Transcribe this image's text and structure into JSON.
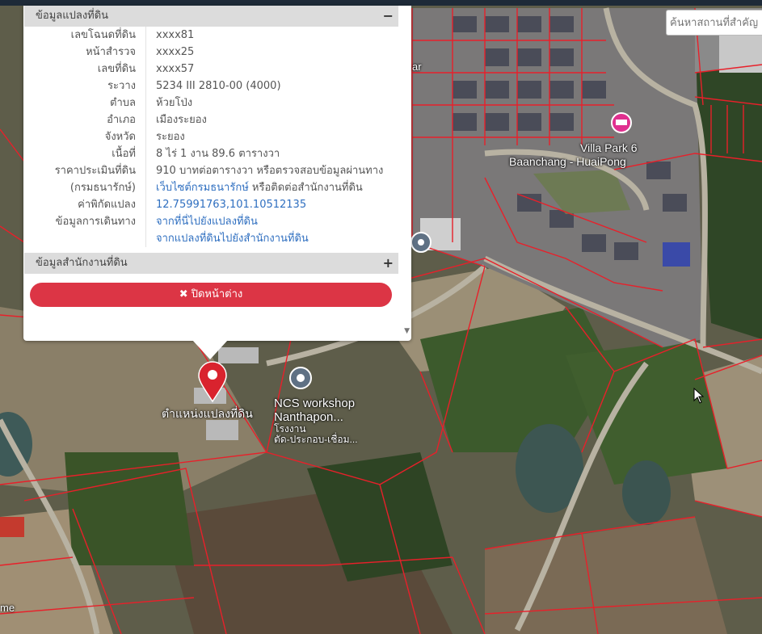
{
  "search": {
    "placeholder": "ค้นหาสถานที่สำคัญ"
  },
  "map_labels": {
    "villa_line1": "Villa Park 6",
    "villa_line2": "Baanchang - HuaiPong",
    "ncs_line1": "NCS workshop",
    "ncs_line2": "Nanthapon...",
    "ncs_line3": "โรงงาน",
    "ncs_line4": "ตัด-ประกอบ-เชื่อม...",
    "parcel_marker": "ตำแหน่งแปลงที่ดิน",
    "edge_ar": "ar",
    "edge_me": "me"
  },
  "panel": {
    "section1_title": "ข้อมูลแปลงที่ดิน",
    "section1_toggle": "−",
    "section2_title": "ข้อมูลสำนักงานที่ดิน",
    "section2_toggle": "+",
    "close_label": "✖ ปิดหน้าต่าง",
    "scroll_arrow": "▼",
    "rows": [
      {
        "label": "เลขโฉนดที่ดิน",
        "value": "xxxx81"
      },
      {
        "label": "หน้าสำรวจ",
        "value": "xxxx25"
      },
      {
        "label": "เลขที่ดิน",
        "value": "xxxx57"
      },
      {
        "label": "ระวาง",
        "value": "5234 III 2810-00 (4000)"
      },
      {
        "label": "ตำบล",
        "value": "ห้วยโป่ง"
      },
      {
        "label": "อำเภอ",
        "value": "เมืองระยอง"
      },
      {
        "label": "จังหวัด",
        "value": "ระยอง"
      },
      {
        "label": "เนื้อที่",
        "value": "8 ไร่ 1 งาน 89.6 ตารางวา"
      },
      {
        "label": "ราคาประเมินที่ดิน",
        "value": "910 บาทต่อตารางวา หรือตรวจสอบข้อมูลผ่านทาง"
      },
      {
        "label": "(กรมธนารักษ์)",
        "value_link": "เว็บไซต์กรมธนารักษ์",
        "value_rest": " หรือติดต่อสำนักงานที่ดิน"
      },
      {
        "label": "ค่าพิกัดแปลง",
        "value_link": "12.75991763,101.10512135"
      },
      {
        "label": "ข้อมูลการเดินทาง",
        "value_link": "จากที่นี่ไปยังแปลงที่ดิน"
      },
      {
        "label": "",
        "value_link": "จากแปลงที่ดินไปยังสำนักงานที่ดิน"
      }
    ]
  },
  "colors": {
    "parcel_line": "#e8202a",
    "close_button": "#dc3545",
    "link": "#2f6fc0",
    "marker": "#d9232e"
  }
}
